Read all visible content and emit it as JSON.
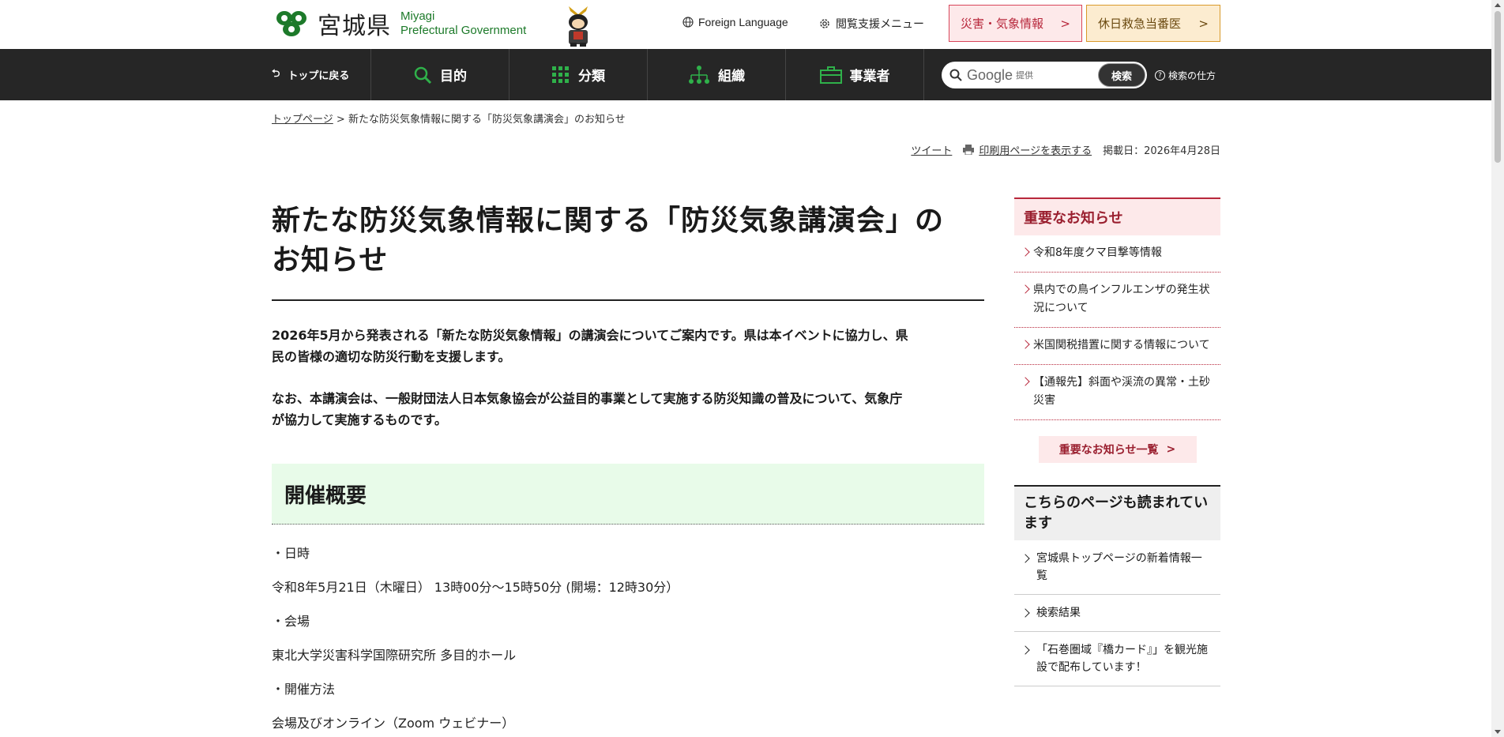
{
  "header": {
    "logo_name": "宮城県",
    "logo_en_line1": "Miyagi",
    "logo_en_line2": "Prefectural Government",
    "foreign_language": "Foreign Language",
    "accessibility_menu": "閲覧支援メニュー",
    "disaster_info": "災害・気象情報",
    "holiday_clinic": "休日救急当番医"
  },
  "nav": {
    "back_to_top": "トップに戻る",
    "purpose": "目的",
    "category": "分類",
    "organization": "組織",
    "business": "事業者",
    "search_google": "Google",
    "search_provided": "提供",
    "search_button": "検索",
    "search_help": "検索の仕方"
  },
  "breadcrumb": {
    "home": "トップページ",
    "separator": ">",
    "current": "新たな防災気象情報に関する「防災気象講演会」のお知らせ"
  },
  "meta": {
    "tweet": "ツイート",
    "print": "印刷用ページを表示する",
    "posted": "掲載日：2026年4月28日"
  },
  "main": {
    "title_line1": "新たな防災気象情報に関する「防災気象講演会」の",
    "title_line2": "お知らせ",
    "lead1_line1": "2026年5月から発表される「新たな防災気象情報」の講演会についてご案内です。県は本イベントに協力し、県",
    "lead1_line2": "民の皆様の適切な防災行動を支援します。",
    "lead2_line1": "なお、本講演会は、一般財団法人日本気象協会が公益目的事業として実施する防災知識の普及について、気象庁",
    "lead2_line2": "が協力して実施するものです。",
    "section_heading": "開催概要",
    "items": [
      "・日時",
      "令和8年5月21日（木曜日） 13時00分～15時50分 (開場：12時30分）",
      "・会場",
      "東北大学災害科学国際研究所 多目的ホール",
      "・開催方法",
      "会場及びオンライン（Zoom ウェビナー）"
    ]
  },
  "sidebar": {
    "important_heading": "重要なお知らせ",
    "important_items": [
      "令和8年度クマ目撃等情報",
      "県内での鳥インフルエンザの発生状況について",
      "米国関税措置に関する情報について",
      "【通報先】斜面や渓流の異常・土砂災害"
    ],
    "important_more": "重要なお知らせ一覧",
    "read_heading": "こちらのページも読まれています",
    "read_items": [
      "宮城県トップページの新着情報一覧",
      "検索結果",
      "「石巻圏域『橋カード』」を観光施設で配布しています！"
    ]
  },
  "colors": {
    "nav_bg": "#262626",
    "brand_green": "#1d7a2a",
    "disaster_red": "#b8283c",
    "holiday_orange": "#d99a2b",
    "section_bg": "#e8fbe9"
  }
}
